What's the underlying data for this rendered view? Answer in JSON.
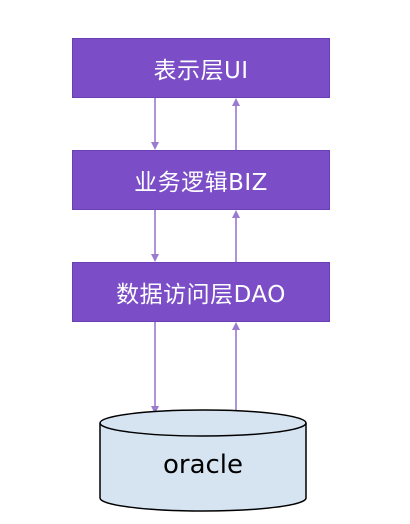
{
  "diagram": {
    "layers": [
      {
        "label": "表示层UI"
      },
      {
        "label": "业务逻辑BIZ"
      },
      {
        "label": "数据访问层DAO"
      }
    ],
    "database": {
      "label": "oracle"
    }
  },
  "colors": {
    "layer_fill": "#7b4ec7",
    "arrow": "#9a7bd0",
    "db_fill": "#d6e4f2",
    "db_stroke": "#000000"
  }
}
